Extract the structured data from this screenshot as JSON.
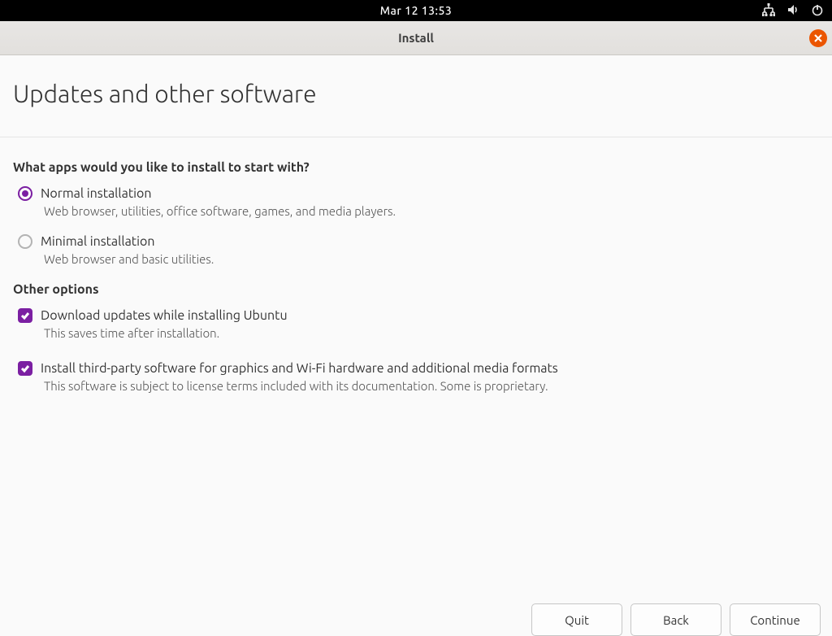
{
  "topbar": {
    "datetime": "Mar 12  13:53"
  },
  "window": {
    "title": "Install"
  },
  "page": {
    "title": "Updates and other software"
  },
  "apps_section": {
    "heading": "What apps would you like to install to start with?",
    "normal": {
      "label": "Normal installation",
      "desc": "Web browser, utilities, office software, games, and media players."
    },
    "minimal": {
      "label": "Minimal installation",
      "desc": "Web browser and basic utilities."
    }
  },
  "other_section": {
    "heading": "Other options",
    "updates": {
      "label": "Download updates while installing Ubuntu",
      "desc": "This saves time after installation."
    },
    "thirdparty": {
      "label": "Install third-party software for graphics and Wi-Fi hardware and additional media formats",
      "desc": "This software is subject to license terms included with its documentation. Some is proprietary."
    }
  },
  "buttons": {
    "quit": "Quit",
    "back": "Back",
    "continue": "Continue"
  }
}
